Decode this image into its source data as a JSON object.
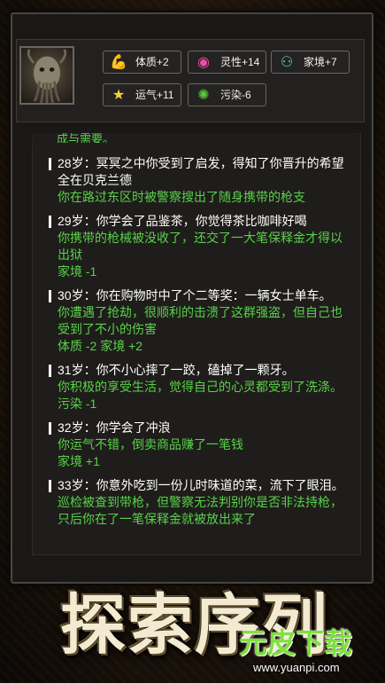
{
  "stats": [
    {
      "icon": "muscle-icon",
      "label": "体质+2",
      "color": "#f0a23a"
    },
    {
      "icon": "brain-icon",
      "label": "灵性+14",
      "color": "#e64fa8"
    },
    {
      "icon": "family-icon",
      "label": "家境+7",
      "color": "#4dd6c8"
    },
    {
      "icon": "star-icon",
      "label": "运气+11",
      "color": "#f5d23a"
    },
    {
      "icon": "virus-icon",
      "label": "污染-6",
      "color": "#57c83d"
    }
  ],
  "log": {
    "cut_top": "成与需要。",
    "entries": [
      {
        "age": "28岁：冥冥之中你受到了启发，得知了你晋升的希望全在贝克兰德",
        "green": "你在路过东区时被警察搜出了随身携带的枪支"
      },
      {
        "age": "29岁：你学会了品鉴茶，你觉得茶比咖啡好喝",
        "green": "你携带的枪械被没收了，还交了一大笔保释金才得以出狱",
        "effect": "家境 -1"
      },
      {
        "age": "30岁：你在购物时中了个二等奖：一辆女士单车。",
        "green": "你遭遇了抢劫，很顺利的击溃了这群强盗，但自己也受到了不小的伤害",
        "effect": "体质 -2 家境 +2"
      },
      {
        "age": "31岁：你不小心摔了一跤，磕掉了一颗牙。",
        "green": "你积极的享受生活，觉得自己的心灵都受到了洗涤。",
        "effect": "污染 -1"
      },
      {
        "age": "32岁：你学会了冲浪",
        "green": "你运气不错，倒卖商品赚了一笔钱",
        "effect": "家境 +1"
      },
      {
        "age": "33岁：你意外吃到一份儿时味道的菜，流下了眼泪。",
        "green": "巡检被查到带枪，但警察无法判别你是否非法持枪，只后你在了一笔保释金就被放出来了"
      }
    ]
  },
  "banner_title": "探索序列",
  "watermark": {
    "main": "元皮下载",
    "sub": "www.yuanpi.com"
  }
}
